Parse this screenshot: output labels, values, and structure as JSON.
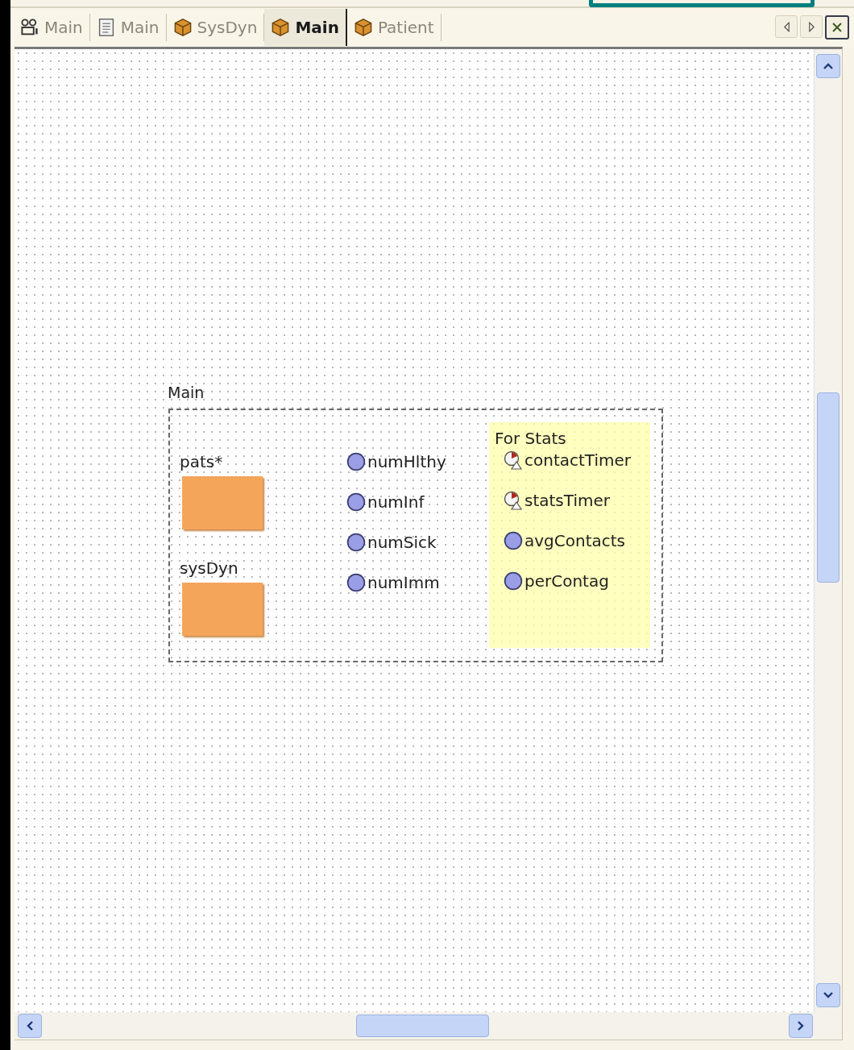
{
  "tabs": [
    {
      "label": "Main",
      "kind": "agents",
      "selected": false
    },
    {
      "label": "Main",
      "kind": "document",
      "selected": false
    },
    {
      "label": "SysDyn",
      "kind": "class",
      "selected": false
    },
    {
      "label": "Main",
      "kind": "class",
      "selected": true
    },
    {
      "label": "Patient",
      "kind": "class",
      "selected": false
    }
  ],
  "diagram": {
    "frame_label": "Main",
    "embedded_objects": [
      {
        "name": "pats*"
      },
      {
        "name": "sysDyn"
      }
    ],
    "variables": [
      {
        "name": "numHlthy"
      },
      {
        "name": "numInf"
      },
      {
        "name": "numSick"
      },
      {
        "name": "numImm"
      }
    ],
    "stats_area": {
      "title": "For Stats",
      "items": [
        {
          "name": "contactTimer",
          "kind": "event"
        },
        {
          "name": "statsTimer",
          "kind": "event"
        },
        {
          "name": "avgContacts",
          "kind": "variable"
        },
        {
          "name": "perContag",
          "kind": "variable"
        }
      ]
    }
  }
}
